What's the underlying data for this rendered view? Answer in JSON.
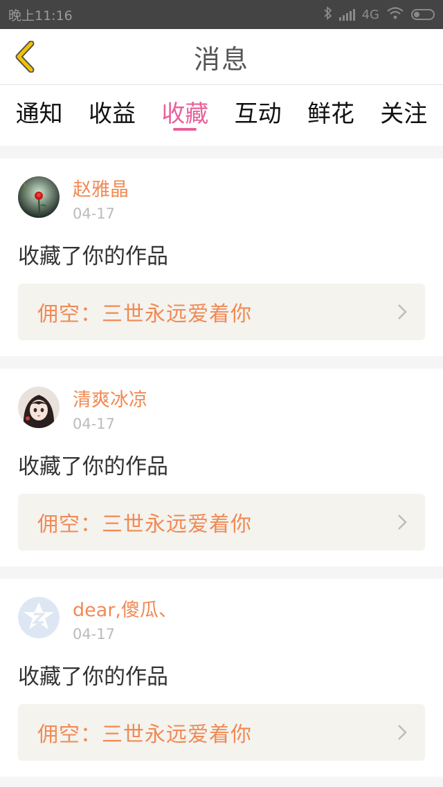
{
  "status_bar": {
    "time": "晚上11:16",
    "network": "4G"
  },
  "header": {
    "title": "消息"
  },
  "tabs": [
    {
      "label": "通知",
      "active": false
    },
    {
      "label": "收益",
      "active": false
    },
    {
      "label": "收藏",
      "active": true
    },
    {
      "label": "互动",
      "active": false
    },
    {
      "label": "鲜花",
      "active": false
    },
    {
      "label": "关注",
      "active": false
    }
  ],
  "messages": [
    {
      "username": "赵雅晶",
      "date": "04-17",
      "action": "收藏了你的作品",
      "work_title": "佣空：三世永远爱着你",
      "avatar": "rose-avatar"
    },
    {
      "username": "清爽冰凉",
      "date": "04-17",
      "action": "收藏了你的作品",
      "work_title": "佣空：三世永远爱着你",
      "avatar": "girl-avatar"
    },
    {
      "username": "dear,傻瓜、",
      "date": "04-17",
      "action": "收藏了你的作品",
      "work_title": "佣空：三世永远爱着你",
      "avatar": "default-avatar"
    }
  ],
  "colors": {
    "accent": "#e8609a",
    "name": "#f08a55",
    "back_arrow": "#f2c200"
  }
}
